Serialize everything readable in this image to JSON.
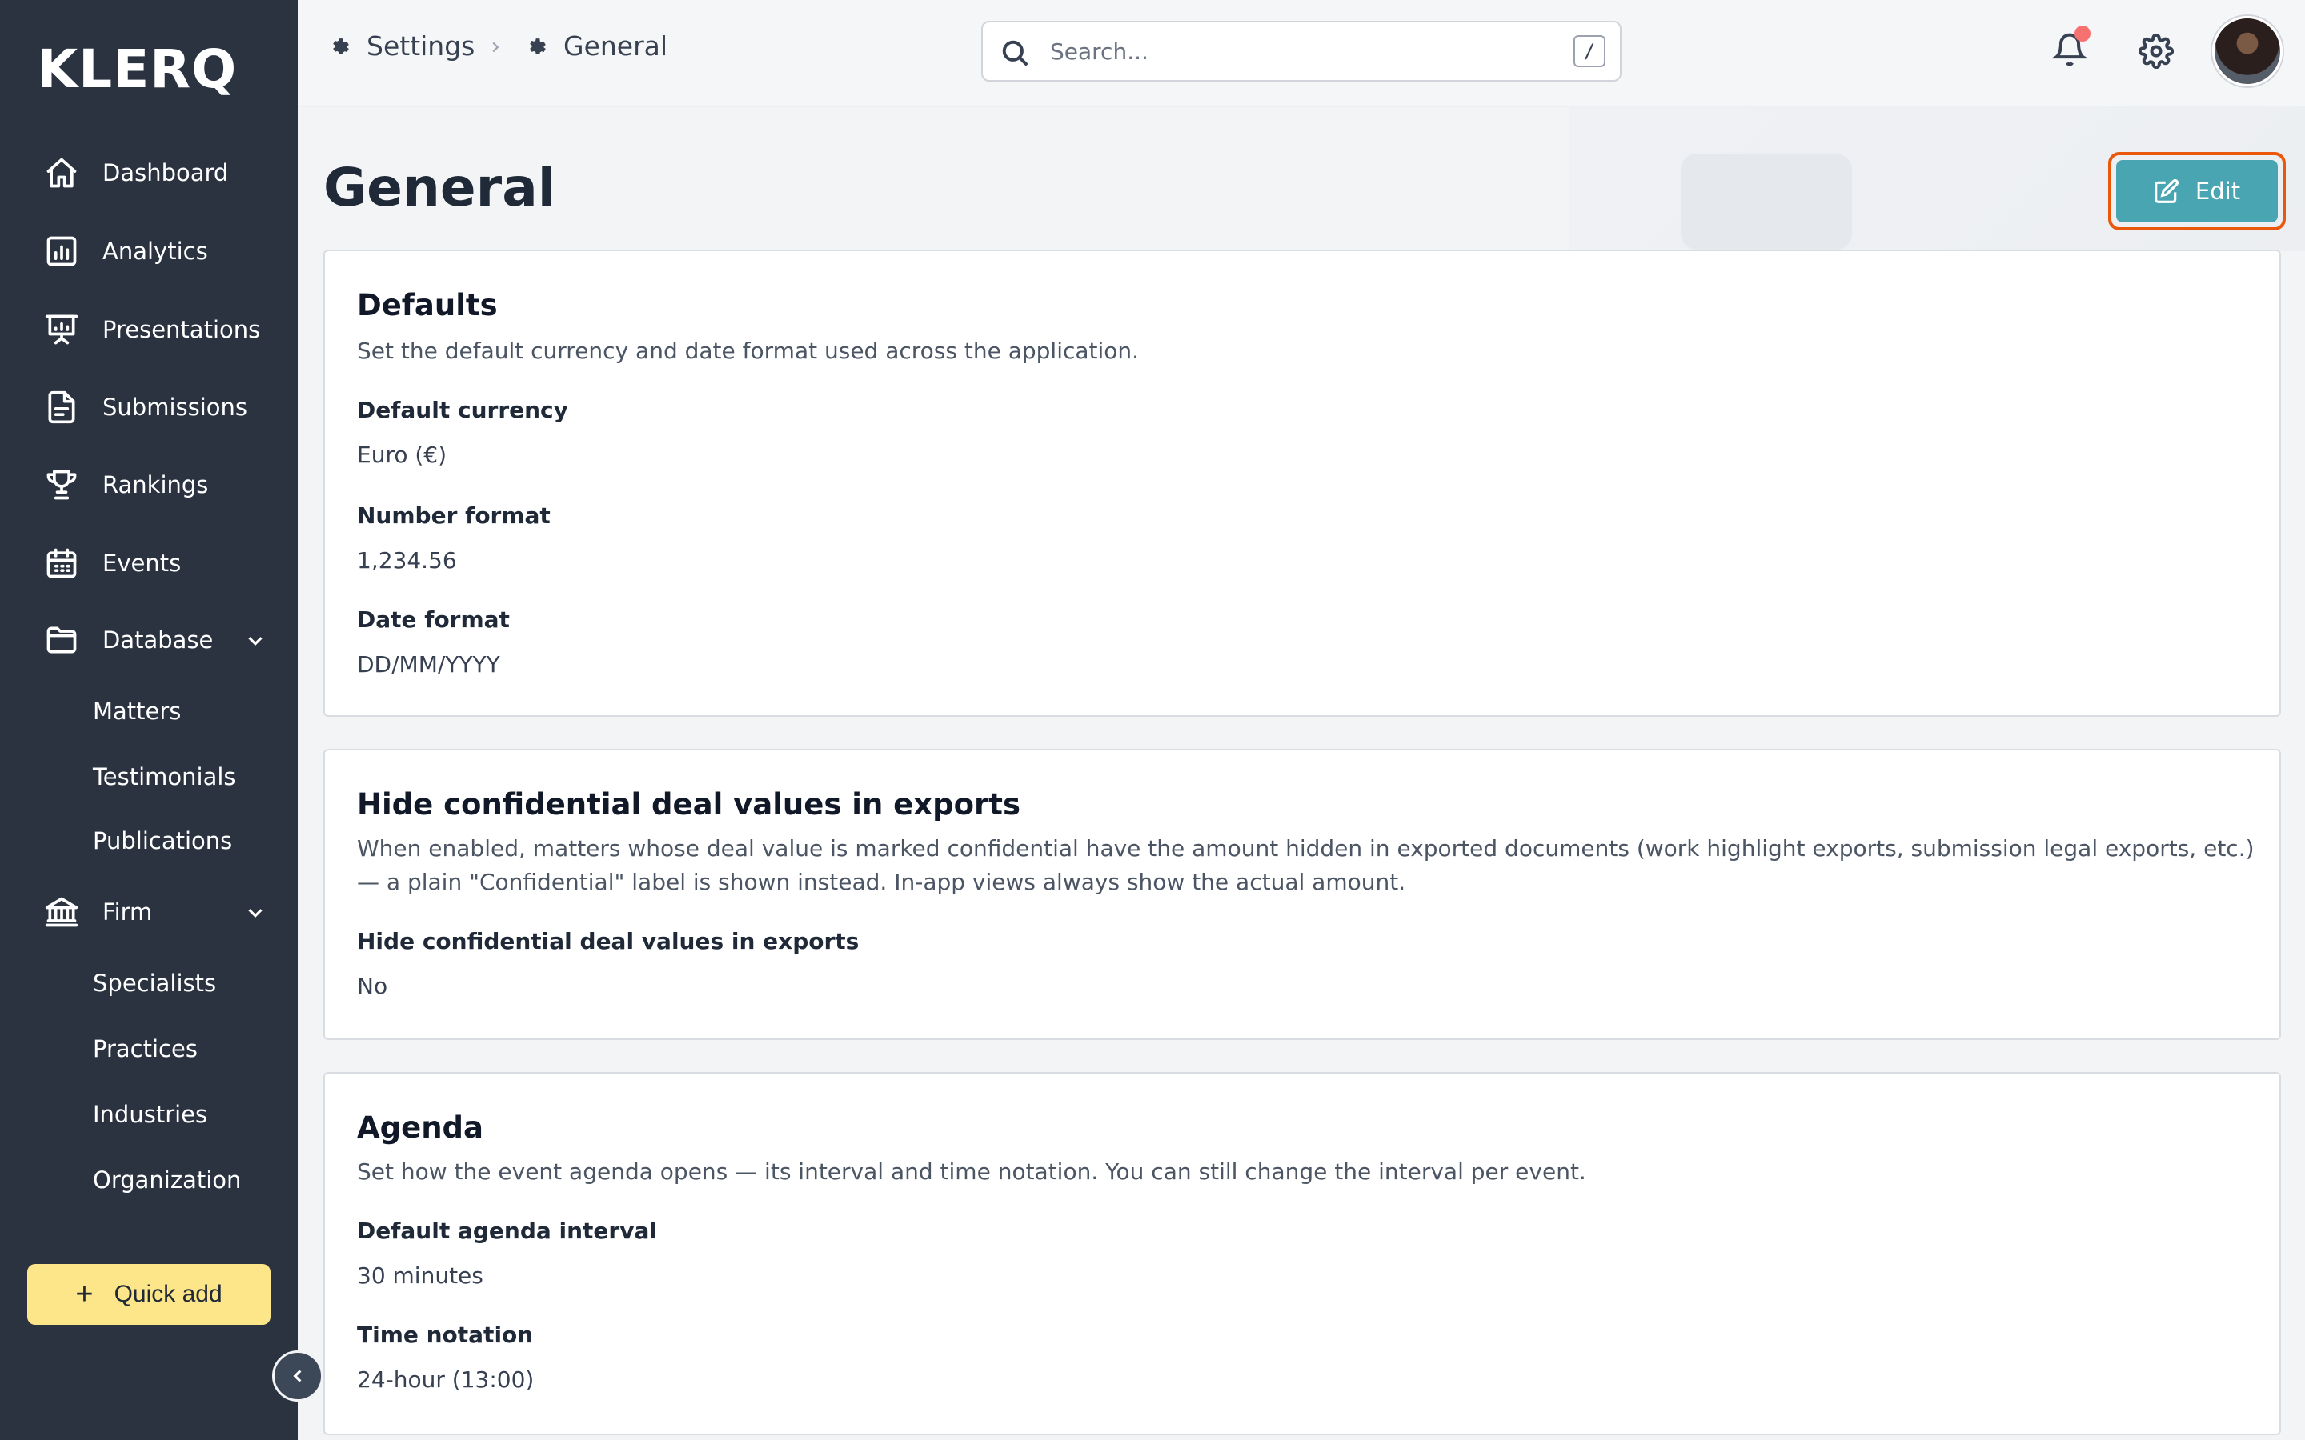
{
  "app": {
    "logo": "KLERQ"
  },
  "sidebar": {
    "nav": [
      {
        "label": "Dashboard",
        "icon": "home-icon"
      },
      {
        "label": "Analytics",
        "icon": "chart-icon"
      },
      {
        "label": "Presentations",
        "icon": "presentation-icon"
      },
      {
        "label": "Submissions",
        "icon": "document-icon"
      },
      {
        "label": "Rankings",
        "icon": "trophy-icon"
      },
      {
        "label": "Events",
        "icon": "calendar-icon"
      },
      {
        "label": "Database",
        "icon": "folder-icon"
      },
      {
        "label": "Firm",
        "icon": "bank-icon"
      }
    ],
    "database_sub": [
      "Matters",
      "Testimonials",
      "Publications"
    ],
    "firm_sub": [
      "Specialists",
      "Practices",
      "Industries",
      "Organization"
    ],
    "quick_add": "Quick add"
  },
  "topbar": {
    "breadcrumb": [
      "Settings",
      "General"
    ],
    "search_placeholder": "Search...",
    "search_shortcut": "/"
  },
  "page": {
    "title": "General",
    "edit_label": "Edit"
  },
  "cards": {
    "defaults": {
      "title": "Defaults",
      "description": "Set the default currency and date format used across the application.",
      "fields": [
        {
          "label": "Default currency",
          "value": "Euro (€)"
        },
        {
          "label": "Number format",
          "value": "1,234.56"
        },
        {
          "label": "Date format",
          "value": "DD/MM/YYYY"
        }
      ]
    },
    "confidential": {
      "title": "Hide confidential deal values in exports",
      "description": "When enabled, matters whose deal value is marked confidential have the amount hidden in exported documents (work highlight exports, submission legal exports, etc.) — a plain \"Confidential\" label is shown instead. In-app views always show the actual amount.",
      "fields": [
        {
          "label": "Hide confidential deal values in exports",
          "value": "No"
        }
      ]
    },
    "agenda": {
      "title": "Agenda",
      "description": "Set how the event agenda opens — its interval and time notation. You can still change the interval per event.",
      "fields": [
        {
          "label": "Default agenda interval",
          "value": "30 minutes"
        },
        {
          "label": "Time notation",
          "value": "24-hour (13:00)"
        }
      ]
    }
  },
  "colors": {
    "sidebar_bg": "#2b3340",
    "accent": "#4aa5b3",
    "highlight": "#ea580c",
    "quick_add_bg": "#fde68a",
    "notification": "#f87171"
  }
}
